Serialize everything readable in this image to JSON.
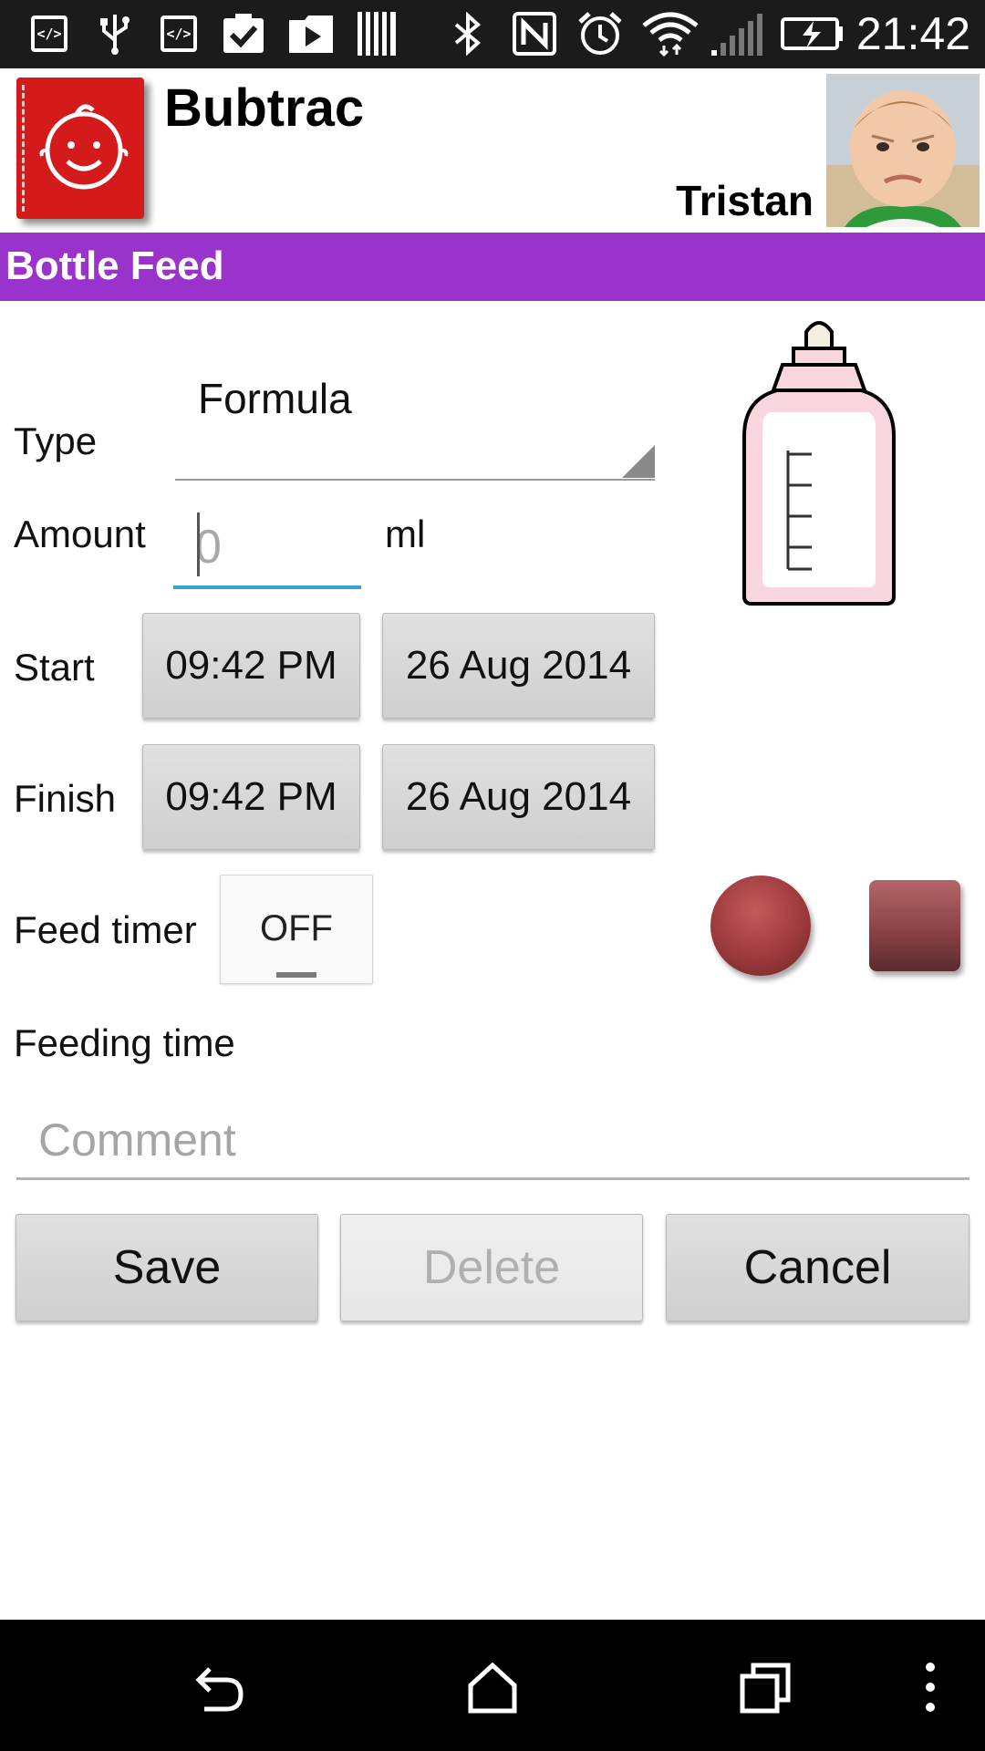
{
  "status_bar": {
    "time": "21:42",
    "icons": [
      "code-icon",
      "usb-icon",
      "code-icon",
      "clipboard-check-icon",
      "play-store-icon",
      "barcode-icon",
      "bluetooth-icon",
      "nfc-icon",
      "alarm-icon",
      "wifi-icon",
      "signal-icon",
      "battery-charging-icon"
    ]
  },
  "header": {
    "app_name": "Bubtrac",
    "child_name": "Tristan"
  },
  "section": {
    "title": "Bottle Feed"
  },
  "form": {
    "type_label": "Type",
    "type_value": "Formula",
    "amount_label": "Amount",
    "amount_placeholder": "0",
    "amount_unit": "ml",
    "start_label": "Start",
    "start_time": "09:42 PM",
    "start_date": "26 Aug 2014",
    "finish_label": "Finish",
    "finish_time": "09:42 PM",
    "finish_date": "26 Aug 2014",
    "timer_label": "Feed timer",
    "timer_state": "OFF",
    "feeding_time_label": "Feeding time",
    "comment_placeholder": "Comment"
  },
  "actions": {
    "save": "Save",
    "delete": "Delete",
    "cancel": "Cancel"
  },
  "colors": {
    "section_bar": "#9933cc",
    "logo": "#d41a1a",
    "input_focus": "#33a3d4"
  }
}
